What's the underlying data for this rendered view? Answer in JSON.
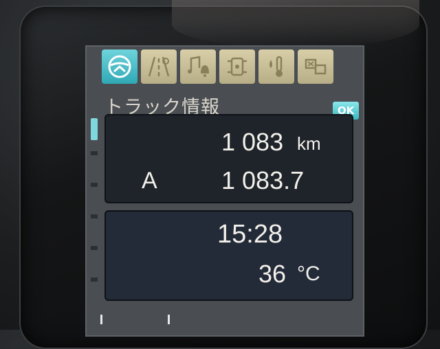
{
  "tabs": [
    {
      "icon": "steering-wheel-icon",
      "active": true
    },
    {
      "icon": "road-icon",
      "active": false
    },
    {
      "icon": "music-bell-icon",
      "active": false
    },
    {
      "icon": "vehicle-settings-icon",
      "active": false
    },
    {
      "icon": "thermometer-icon",
      "active": false
    },
    {
      "icon": "dashboard-config-icon",
      "active": false
    }
  ],
  "header": {
    "title": "トラック情報",
    "ok_label": "OK"
  },
  "trip_panel": {
    "odometer_value": "1 083",
    "odometer_unit": "km",
    "trip_label": "A",
    "trip_value": "1 083.7"
  },
  "clock_panel": {
    "time": "15:28",
    "temperature_value": "36",
    "temperature_unit": "°C"
  },
  "colors": {
    "accent": "#3ab9c1",
    "tab_inactive": "#c8bf98",
    "panel_bg": "#1f242b"
  }
}
